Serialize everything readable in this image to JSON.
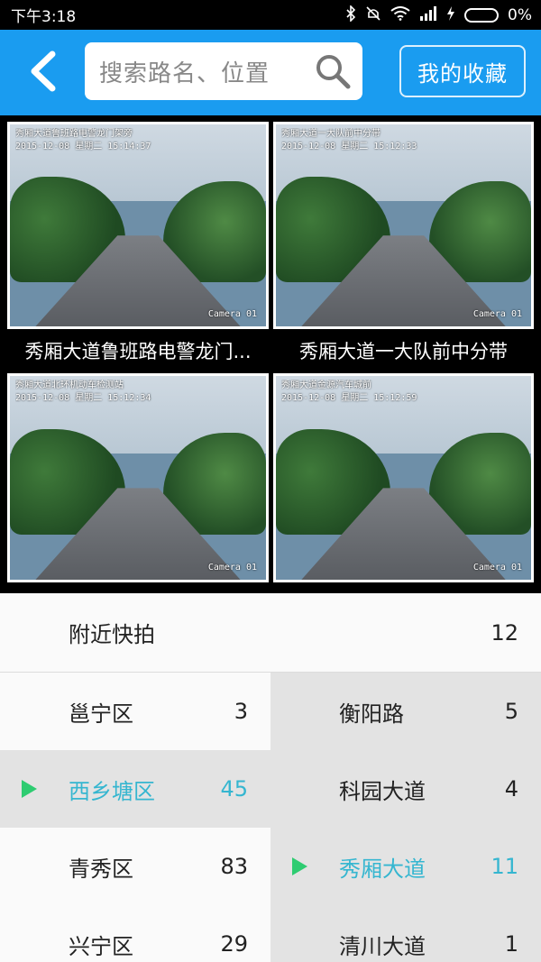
{
  "status_bar": {
    "time": "下午3:18",
    "battery": "0%"
  },
  "header": {
    "search_placeholder": "搜索路名、位置",
    "favorites_label": "我的收藏"
  },
  "cameras": [
    {
      "title": "秀厢大道鲁班路电警龙门...",
      "overlay": "秀厢大道鲁班路电警龙门架旁\n2015-12-08 星期二 15:14:37",
      "camera_id": "Camera 01"
    },
    {
      "title": "秀厢大道一大队前中分带",
      "overlay": "秀厢大道一大队前中分带\n2015-12-08 星期二 15:12:33",
      "camera_id": "Camera 01"
    },
    {
      "title": "",
      "overlay": "秀厢大道北环机动车检测站\n2015-12-08 星期二 15:12:34",
      "camera_id": "Camera 01"
    },
    {
      "title": "",
      "overlay": "秀厢大道金源汽车城前\n2015-12-08 星期二 15:12:59",
      "camera_id": "Camera 01"
    }
  ],
  "nearby": {
    "label": "附近快拍",
    "count": "12"
  },
  "districts": [
    {
      "label": "邕宁区",
      "count": "3",
      "selected": false
    },
    {
      "label": "西乡塘区",
      "count": "45",
      "selected": true
    },
    {
      "label": "青秀区",
      "count": "83",
      "selected": false
    },
    {
      "label": "兴宁区",
      "count": "29",
      "selected": false
    }
  ],
  "roads": [
    {
      "label": "衡阳路",
      "count": "5",
      "selected": false
    },
    {
      "label": "科园大道",
      "count": "4",
      "selected": false
    },
    {
      "label": "秀厢大道",
      "count": "11",
      "selected": true
    },
    {
      "label": "清川大道",
      "count": "1",
      "selected": false
    }
  ],
  "colors": {
    "header": "#1a9cf0",
    "accent": "#35b6d0",
    "arrow": "#2ecc71"
  },
  "icons": [
    "back-arrow-icon",
    "search-icon",
    "bluetooth-icon",
    "silent-icon",
    "wifi-icon",
    "signal-icon",
    "charging-icon",
    "battery-icon"
  ]
}
